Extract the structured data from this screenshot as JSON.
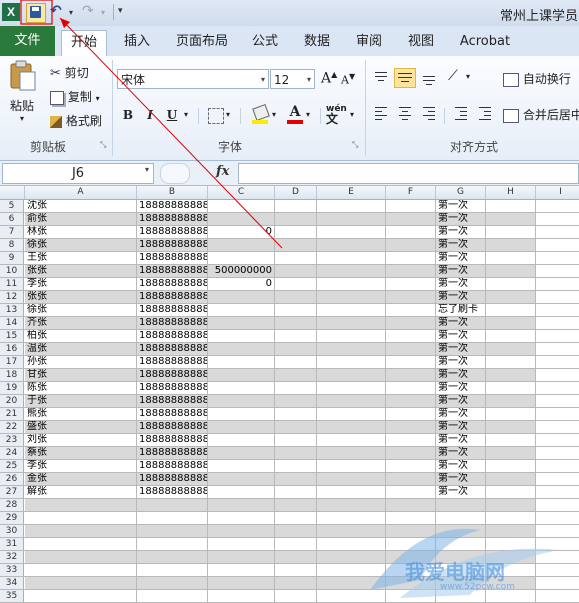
{
  "window_title": "常州上课学员",
  "app_logo": "X",
  "qat": {
    "save_icon": "save-icon",
    "undo_icon": "undo-icon",
    "redo_icon": "redo-icon",
    "undo_glyph": "↶",
    "redo_glyph": "↷",
    "dropdown_glyph": "▾",
    "customize_glyph": "▾"
  },
  "tabs": [
    "文件",
    "开始",
    "插入",
    "页面布局",
    "公式",
    "数据",
    "审阅",
    "视图",
    "Acrobat"
  ],
  "ribbon": {
    "clipboard": {
      "paste": "粘贴",
      "cut": "剪切",
      "copy": "复制",
      "format_painter": "格式刷",
      "label": "剪贴板"
    },
    "font": {
      "name": "宋体",
      "size": "12",
      "grow": "A",
      "shrink": "A",
      "bold": "B",
      "italic": "I",
      "underline": "U",
      "font_color": "A",
      "phonetic": "wén",
      "label": "字体"
    },
    "alignment": {
      "wrap_text": "自动换行",
      "merge_center": "合并后居中",
      "label": "对齐方式"
    }
  },
  "formula_bar": {
    "name_box": "J6",
    "fx": "fx",
    "formula": ""
  },
  "columns": [
    "A",
    "B",
    "C",
    "D",
    "E",
    "F",
    "G",
    "H",
    "I"
  ],
  "rows": [
    {
      "n": "5",
      "a": "沈张",
      "b": "18888888888",
      "c": "",
      "g": "第一次"
    },
    {
      "n": "6",
      "a": "俞张",
      "b": "18888888888",
      "c": "",
      "g": "第一次"
    },
    {
      "n": "7",
      "a": "林张",
      "b": "18888888888",
      "c": "0",
      "g": "第一次"
    },
    {
      "n": "8",
      "a": "徐张",
      "b": "18888888888",
      "c": "",
      "g": "第一次"
    },
    {
      "n": "9",
      "a": "王张",
      "b": "18888888888",
      "c": "",
      "g": "第一次"
    },
    {
      "n": "10",
      "a": "张张",
      "b": "18888888888",
      "c": "500000000",
      "g": "第一次"
    },
    {
      "n": "11",
      "a": "李张",
      "b": "18888888888",
      "c": "0",
      "g": "第一次"
    },
    {
      "n": "12",
      "a": "张张",
      "b": "18888888888",
      "c": "",
      "g": "第一次"
    },
    {
      "n": "13",
      "a": "徐张",
      "b": "18888888888",
      "c": "",
      "g": "忘了刷卡"
    },
    {
      "n": "14",
      "a": "齐张",
      "b": "18888888888",
      "c": "",
      "g": "第一次"
    },
    {
      "n": "15",
      "a": "柏张",
      "b": "18888888888",
      "c": "",
      "g": "第一次"
    },
    {
      "n": "16",
      "a": "温张",
      "b": "18888888888",
      "c": "",
      "g": "第一次"
    },
    {
      "n": "17",
      "a": "孙张",
      "b": "18888888888",
      "c": "",
      "g": "第一次"
    },
    {
      "n": "18",
      "a": "甘张",
      "b": "18888888888",
      "c": "",
      "g": "第一次"
    },
    {
      "n": "19",
      "a": "陈张",
      "b": "18888888888",
      "c": "",
      "g": "第一次"
    },
    {
      "n": "20",
      "a": "于张",
      "b": "18888888888",
      "c": "",
      "g": "第一次"
    },
    {
      "n": "21",
      "a": "熊张",
      "b": "18888888888",
      "c": "",
      "g": "第一次"
    },
    {
      "n": "22",
      "a": "盛张",
      "b": "18888888888",
      "c": "",
      "g": "第一次"
    },
    {
      "n": "23",
      "a": "刘张",
      "b": "18888888888",
      "c": "",
      "g": "第一次"
    },
    {
      "n": "24",
      "a": "蔡张",
      "b": "18888888888",
      "c": "",
      "g": "第一次"
    },
    {
      "n": "25",
      "a": "李张",
      "b": "18888888888",
      "c": "",
      "g": "第一次"
    },
    {
      "n": "26",
      "a": "金张",
      "b": "18888888888",
      "c": "",
      "g": "第一次"
    },
    {
      "n": "27",
      "a": "解张",
      "b": "18888888888",
      "c": "",
      "g": "第一次"
    },
    {
      "n": "28",
      "a": "",
      "b": "",
      "c": "",
      "g": ""
    },
    {
      "n": "29",
      "a": "",
      "b": "",
      "c": "",
      "g": ""
    },
    {
      "n": "30",
      "a": "",
      "b": "",
      "c": "",
      "g": ""
    },
    {
      "n": "31",
      "a": "",
      "b": "",
      "c": "",
      "g": ""
    },
    {
      "n": "32",
      "a": "",
      "b": "",
      "c": "",
      "g": ""
    },
    {
      "n": "33",
      "a": "",
      "b": "",
      "c": "",
      "g": ""
    },
    {
      "n": "34",
      "a": "",
      "b": "",
      "c": "",
      "g": ""
    },
    {
      "n": "35",
      "a": "",
      "b": "",
      "c": "",
      "g": ""
    }
  ],
  "colors": {
    "file_tab": "#2a7a3b",
    "row_shade": "#d9d9d9",
    "annotation": "#e00000",
    "watermark": "#4a90d9"
  },
  "watermark": {
    "text": "我爱电脑网",
    "sub": "www.52pcw.com"
  }
}
